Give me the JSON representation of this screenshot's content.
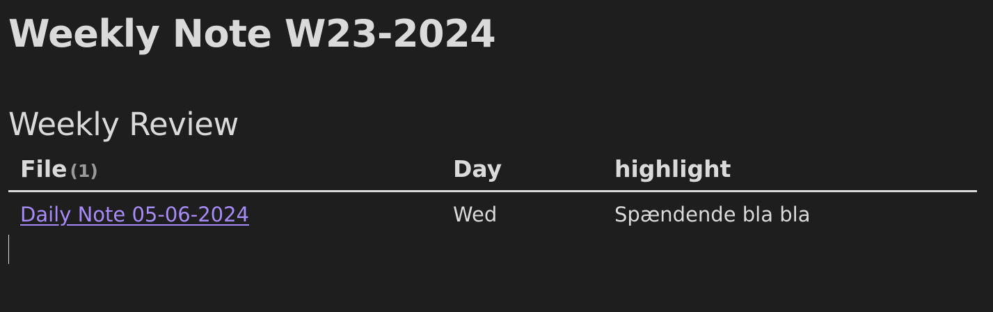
{
  "note": {
    "title": "Weekly Note W23-2024",
    "section_heading": "Weekly Review"
  },
  "table": {
    "columns": {
      "file": "File",
      "file_count": "(1)",
      "day": "Day",
      "highlight": "highlight"
    },
    "rows": [
      {
        "file": "Daily Note 05-06-2024",
        "day": "Wed",
        "highlight": "Spændende bla bla"
      }
    ]
  },
  "colors": {
    "background": "#1e1e1e",
    "text": "#dadada",
    "link": "#a88bfa",
    "muted": "#9a9a9a"
  }
}
